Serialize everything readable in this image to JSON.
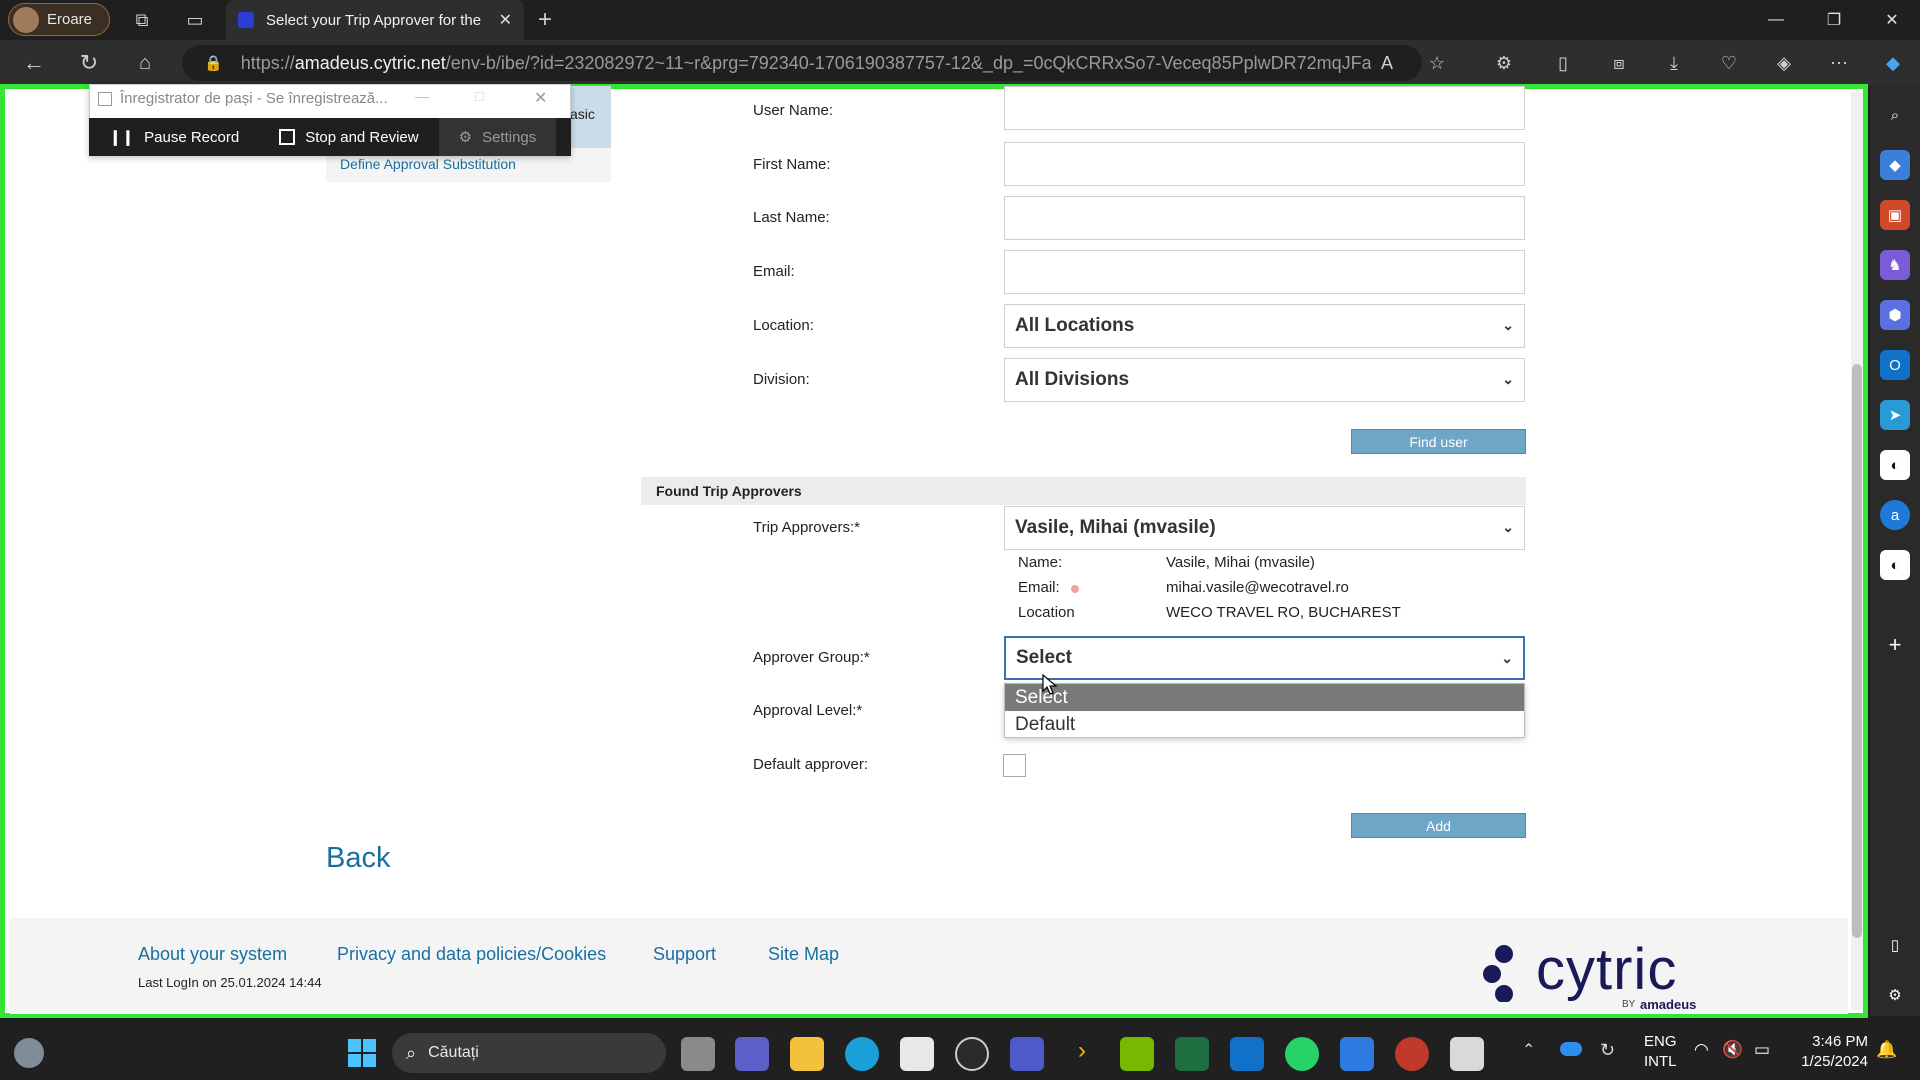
{
  "browser": {
    "profile_name": "Eroare",
    "tab_title": "Select your Trip Approver for the",
    "url_prefix": "https://",
    "url_domain": "amadeus.cytric.net",
    "url_path": "/env-b/ibe/?id=232082972~11~r&prg=792340-1706190387757-12&_dp_=0cQkCRRxSo7-Veceq85PplwDR72mqJFa4..."
  },
  "recorder": {
    "title": "Înregistrator de pași - Se înregistrează...",
    "pause_label": "Pause Record",
    "stop_label": "Stop and Review",
    "settings_label": "Settings",
    "partial_text": "asic"
  },
  "page": {
    "define_link": "Define Approval Substitution",
    "labels": {
      "user_name": "User Name:",
      "first_name": "First Name:",
      "last_name": "Last Name:",
      "email": "Email:",
      "location": "Location:",
      "division": "Division:",
      "trip_approvers": "Trip Approvers:*",
      "approver_group": "Approver Group:*",
      "approval_level": "Approval Level:*",
      "default_approver": "Default approver:"
    },
    "location_value": "All Locations",
    "division_value": "All Divisions",
    "find_user_label": "Find user",
    "section_title": "Found Trip Approvers",
    "trip_approver_value": "Vasile, Mihai (mvasile)",
    "info": {
      "name_label": "Name:",
      "name_value": "Vasile, Mihai (mvasile)",
      "email_label": "Email:",
      "email_value": "mihai.vasile@wecotravel.ro",
      "location_label": "Location",
      "location_value": "WECO TRAVEL RO, BUCHAREST"
    },
    "approver_group_value": "Select",
    "approver_group_options": [
      "Select",
      "Default"
    ],
    "add_label": "Add",
    "back_label": "Back"
  },
  "footer": {
    "links": [
      "About your system",
      "Privacy and data policies/Cookies",
      "Support",
      "Site Map"
    ],
    "last_login": "Last LogIn on 25.01.2024 14:44",
    "logo_text": "cytric",
    "logo_by": "BY",
    "logo_brand": "amadeus"
  },
  "taskbar": {
    "search_label": "Căutați",
    "lang_top": "ENG",
    "lang_bottom": "INTL",
    "time": "3:46 PM",
    "date": "1/25/2024"
  },
  "colors": {
    "frame_green": "#33e633",
    "button_blue": "#6ea6c8",
    "link_blue": "#1a6fa0",
    "cytric_dark": "#1a1a5a"
  }
}
